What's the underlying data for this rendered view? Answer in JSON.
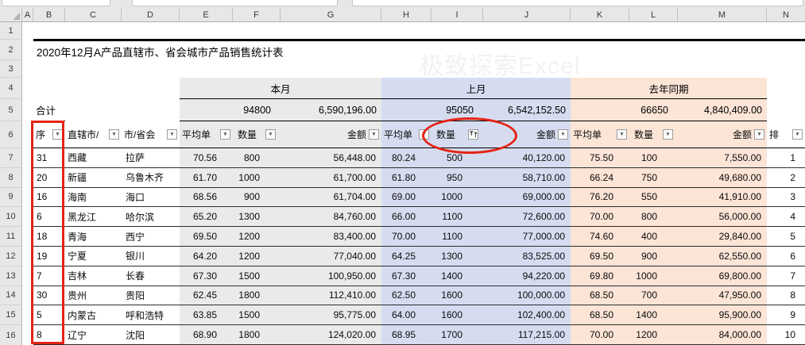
{
  "title": "2020年12月A产品直辖市、省会城市产品销售统计表",
  "watermark": "极致探索Excel",
  "column_headers": [
    "A",
    "B",
    "C",
    "D",
    "E",
    "F",
    "G",
    "H",
    "I",
    "J",
    "K",
    "L",
    "M",
    "N"
  ],
  "row_headers": [
    "1",
    "2",
    "3",
    "4",
    "5",
    "6",
    "7",
    "8",
    "9",
    "10",
    "11",
    "12",
    "13",
    "14",
    "15",
    "16"
  ],
  "sections": {
    "this_month": "本月",
    "last_month": "上月",
    "last_year": "去年同期"
  },
  "totals": {
    "label": "合计",
    "this_month_qty": "94800",
    "this_month_amount": "6,590,196.00",
    "last_month_qty": "95050",
    "last_month_amount": "6,542,152.50",
    "last_year_qty": "66650",
    "last_year_amount": "4,840,409.00"
  },
  "table_headers": {
    "seq": "序",
    "province": "直辖市/",
    "city": "市/省会",
    "avg_price": "平均单",
    "qty": "数量",
    "amount": "金额",
    "rank": "排",
    "dropdown_glyph": "▼"
  },
  "rows": [
    {
      "no": "31",
      "province": "西藏",
      "city": "拉萨",
      "tm_price": "70.56",
      "tm_qty": "800",
      "tm_amount": "56,448.00",
      "lm_price": "80.24",
      "lm_qty": "500",
      "lm_amount": "40,120.00",
      "ly_price": "75.50",
      "ly_qty": "100",
      "ly_amount": "7,550.00",
      "rank": "1"
    },
    {
      "no": "20",
      "province": "新疆",
      "city": "乌鲁木齐",
      "tm_price": "61.70",
      "tm_qty": "1000",
      "tm_amount": "61,700.00",
      "lm_price": "61.80",
      "lm_qty": "950",
      "lm_amount": "58,710.00",
      "ly_price": "66.24",
      "ly_qty": "750",
      "ly_amount": "49,680.00",
      "rank": "2"
    },
    {
      "no": "16",
      "province": "海南",
      "city": "海口",
      "tm_price": "68.56",
      "tm_qty": "900",
      "tm_amount": "61,704.00",
      "lm_price": "69.00",
      "lm_qty": "1000",
      "lm_amount": "69,000.00",
      "ly_price": "76.20",
      "ly_qty": "550",
      "ly_amount": "41,910.00",
      "rank": "3"
    },
    {
      "no": "6",
      "province": "黑龙江",
      "city": "哈尔滨",
      "tm_price": "65.20",
      "tm_qty": "1300",
      "tm_amount": "84,760.00",
      "lm_price": "66.00",
      "lm_qty": "1100",
      "lm_amount": "72,600.00",
      "ly_price": "70.00",
      "ly_qty": "800",
      "ly_amount": "56,000.00",
      "rank": "4"
    },
    {
      "no": "18",
      "province": "青海",
      "city": "西宁",
      "tm_price": "69.50",
      "tm_qty": "1200",
      "tm_amount": "83,400.00",
      "lm_price": "70.00",
      "lm_qty": "1100",
      "lm_amount": "77,000.00",
      "ly_price": "74.60",
      "ly_qty": "400",
      "ly_amount": "29,840.00",
      "rank": "5"
    },
    {
      "no": "19",
      "province": "宁夏",
      "city": "银川",
      "tm_price": "64.20",
      "tm_qty": "1200",
      "tm_amount": "77,040.00",
      "lm_price": "64.25",
      "lm_qty": "1300",
      "lm_amount": "83,525.00",
      "ly_price": "69.50",
      "ly_qty": "900",
      "ly_amount": "62,550.00",
      "rank": "6"
    },
    {
      "no": "7",
      "province": "吉林",
      "city": "长春",
      "tm_price": "67.30",
      "tm_qty": "1500",
      "tm_amount": "100,950.00",
      "lm_price": "67.30",
      "lm_qty": "1400",
      "lm_amount": "94,220.00",
      "ly_price": "69.80",
      "ly_qty": "1000",
      "ly_amount": "69,800.00",
      "rank": "7"
    },
    {
      "no": "30",
      "province": "贵州",
      "city": "贵阳",
      "tm_price": "62.45",
      "tm_qty": "1800",
      "tm_amount": "112,410.00",
      "lm_price": "62.50",
      "lm_qty": "1600",
      "lm_amount": "100,000.00",
      "ly_price": "68.50",
      "ly_qty": "700",
      "ly_amount": "47,950.00",
      "rank": "8"
    },
    {
      "no": "5",
      "province": "内蒙古",
      "city": "呼和浩特",
      "tm_price": "63.85",
      "tm_qty": "1500",
      "tm_amount": "95,775.00",
      "lm_price": "64.00",
      "lm_qty": "1600",
      "lm_amount": "102,400.00",
      "ly_price": "68.50",
      "ly_qty": "1400",
      "ly_amount": "95,900.00",
      "rank": "9"
    },
    {
      "no": "8",
      "province": "辽宁",
      "city": "沈阳",
      "tm_price": "68.90",
      "tm_qty": "1800",
      "tm_amount": "124,020.00",
      "lm_price": "68.95",
      "lm_qty": "1700",
      "lm_amount": "117,215.00",
      "ly_price": "70.00",
      "ly_qty": "1200",
      "ly_amount": "84,000.00",
      "rank": "10"
    }
  ],
  "colors": {
    "this_month_bg": "#EAEAEA",
    "last_month_bg": "#D6DCF0",
    "last_year_bg": "#FCE4D6",
    "annotation_red": "#E42313",
    "muted_text": "#A6A6A6"
  }
}
